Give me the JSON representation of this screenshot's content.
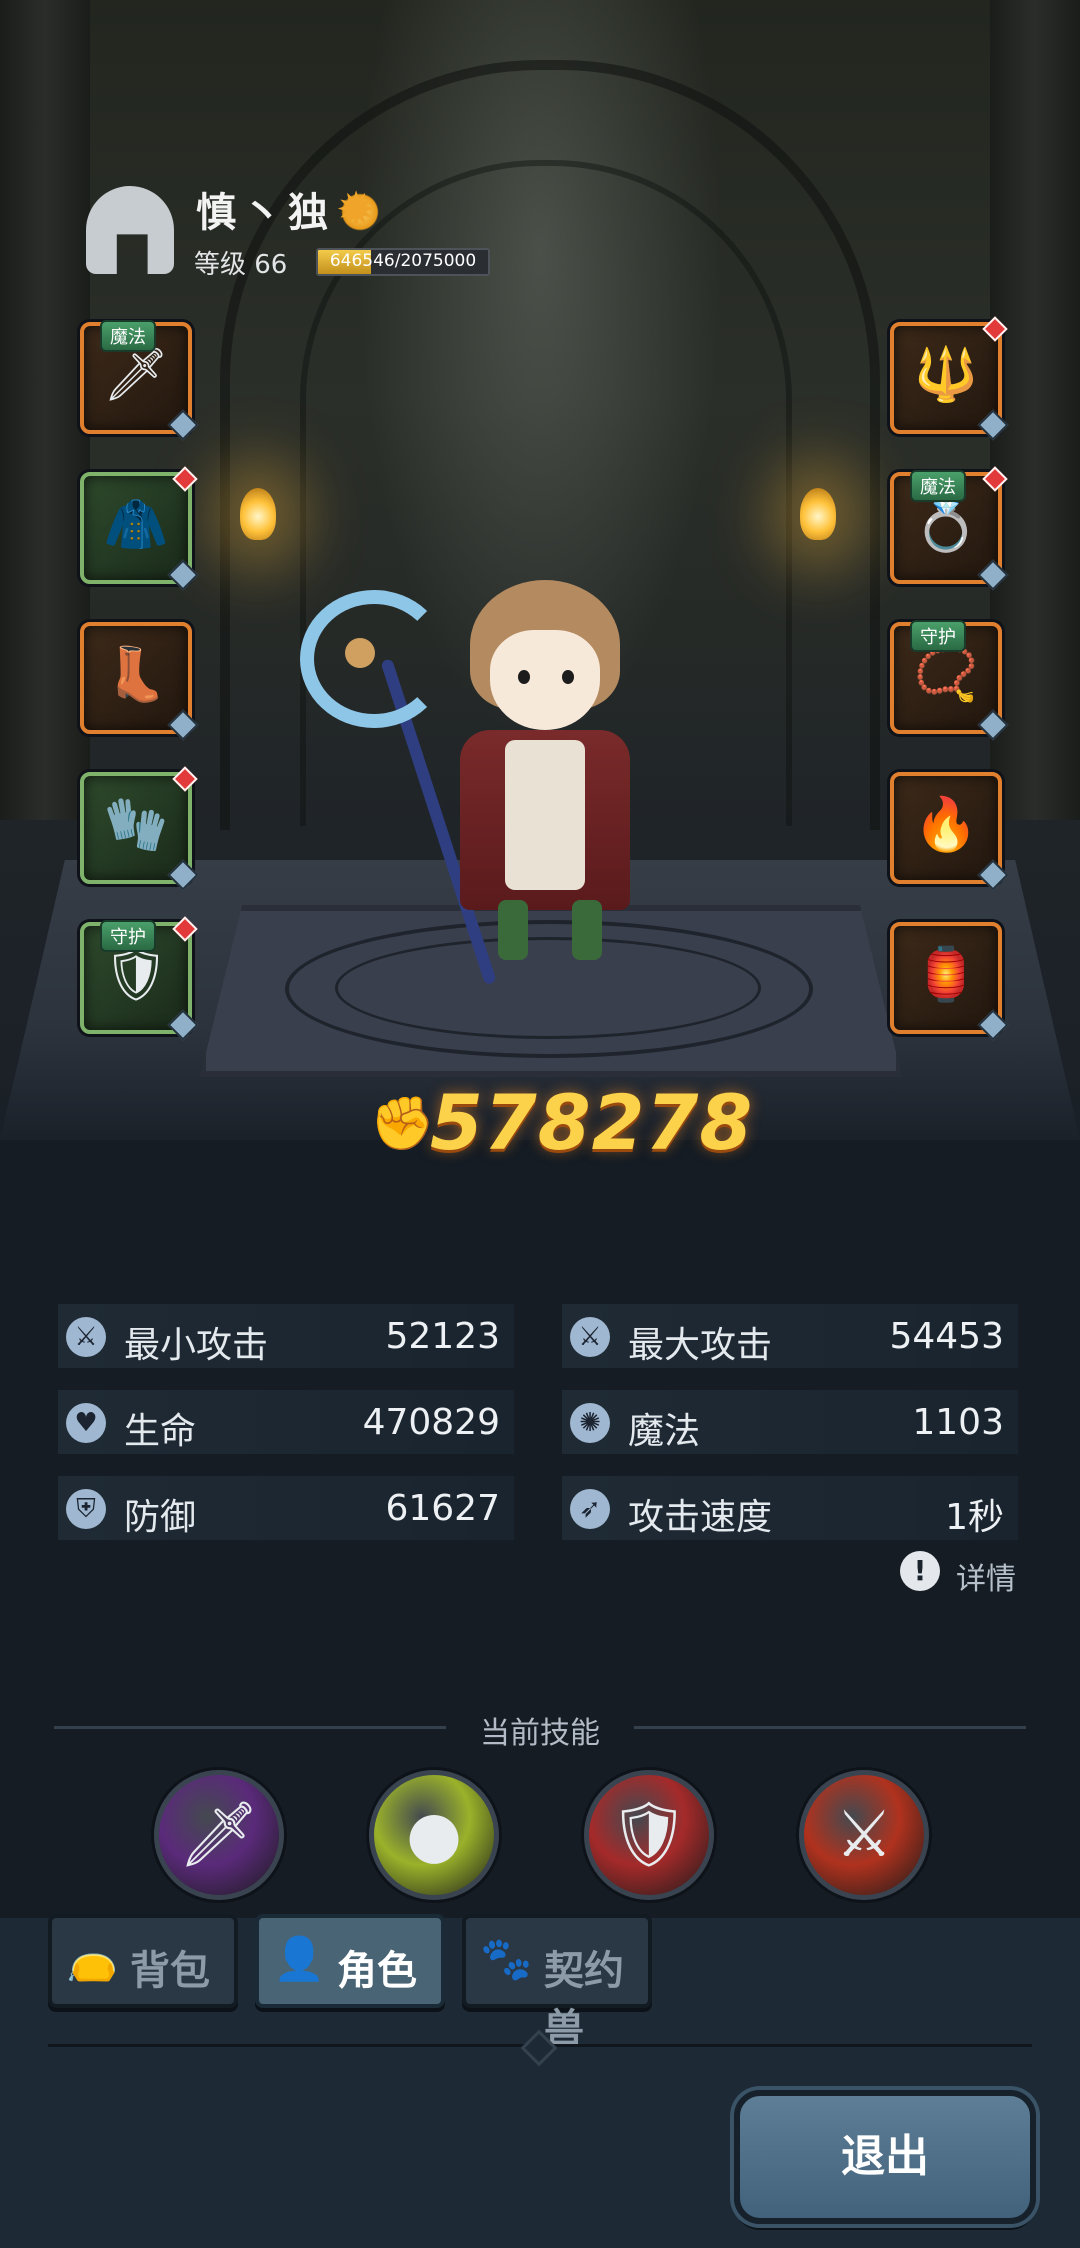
{
  "player": {
    "name": "慎丶独",
    "badge_icon": "sun-badge-icon",
    "level_label": "等级 66",
    "xp_text": "646546/2075000",
    "xp_current": 646546,
    "xp_max": 2075000
  },
  "equipment": {
    "left": [
      {
        "name": "weapon-slot",
        "tag": "魔法",
        "frame": "orange",
        "icon": "bone-sword-icon",
        "glyph": "🗡",
        "gem": false
      },
      {
        "name": "armor-slot",
        "tag": "",
        "frame": "green",
        "icon": "robe-icon",
        "glyph": "🧥",
        "gem": true
      },
      {
        "name": "boots-slot",
        "tag": "",
        "frame": "orange",
        "icon": "boots-icon",
        "glyph": "👢",
        "gem": false
      },
      {
        "name": "bracer-slot",
        "tag": "",
        "frame": "green",
        "icon": "bracer-icon",
        "glyph": "🧤",
        "gem": true
      },
      {
        "name": "shoulder-slot",
        "tag": "守护",
        "frame": "green",
        "icon": "shoulder-armor-icon",
        "glyph": "🛡",
        "gem": true
      }
    ],
    "right": [
      {
        "name": "staff-slot",
        "tag": "",
        "frame": "orange",
        "icon": "staff-icon",
        "glyph": "🔱",
        "gem": true
      },
      {
        "name": "ring-slot",
        "tag": "魔法",
        "frame": "orange",
        "icon": "ring-icon",
        "glyph": "💍",
        "gem": true
      },
      {
        "name": "necklace-slot",
        "tag": "守护",
        "frame": "orange",
        "icon": "necklace-icon",
        "glyph": "📿",
        "gem": false
      },
      {
        "name": "amulet-slot",
        "tag": "",
        "frame": "orange",
        "icon": "flame-amulet-icon",
        "glyph": "🔥",
        "gem": false
      },
      {
        "name": "relic-slot",
        "tag": "",
        "frame": "orange",
        "icon": "relic-icon",
        "glyph": "🏮",
        "gem": false
      }
    ]
  },
  "power": {
    "value": "578278",
    "icon": "power-fist-icon"
  },
  "stats": [
    {
      "label": "最小攻击",
      "value": "52123",
      "icon": "sword-icon",
      "glyph": "⚔"
    },
    {
      "label": "最大攻击",
      "value": "54453",
      "icon": "sword-icon",
      "glyph": "⚔"
    },
    {
      "label": "生命",
      "value": "470829",
      "icon": "heart-icon",
      "glyph": "♥"
    },
    {
      "label": "魔法",
      "value": "1103",
      "icon": "magic-swirl-icon",
      "glyph": "✺"
    },
    {
      "label": "防御",
      "value": "61627",
      "icon": "shield-icon",
      "glyph": "⛨"
    },
    {
      "label": "攻击速度",
      "value": "1秒",
      "icon": "speed-icon",
      "glyph": "➶"
    }
  ],
  "details_label": "详情",
  "skills": {
    "title": "当前技能",
    "items": [
      {
        "icon": "purple-blade-skill-icon",
        "glyph": "🗡",
        "color": "#5a2a7a"
      },
      {
        "icon": "green-orbs-skill-icon",
        "glyph": "●",
        "color": "#9ab22a"
      },
      {
        "icon": "crest-shield-skill-icon",
        "glyph": "🛡",
        "color": "#a52a2a"
      },
      {
        "icon": "crossed-axes-skill-icon",
        "glyph": "⚔",
        "color": "#b0321e"
      }
    ]
  },
  "tabs": [
    {
      "label": "背包",
      "icon": "bag-icon",
      "glyph": "👝",
      "active": false
    },
    {
      "label": "角色",
      "icon": "character-icon",
      "glyph": "👤",
      "active": true
    },
    {
      "label": "契约兽",
      "icon": "paw-icon",
      "glyph": "🐾",
      "active": false
    }
  ],
  "exit_label": "退出"
}
